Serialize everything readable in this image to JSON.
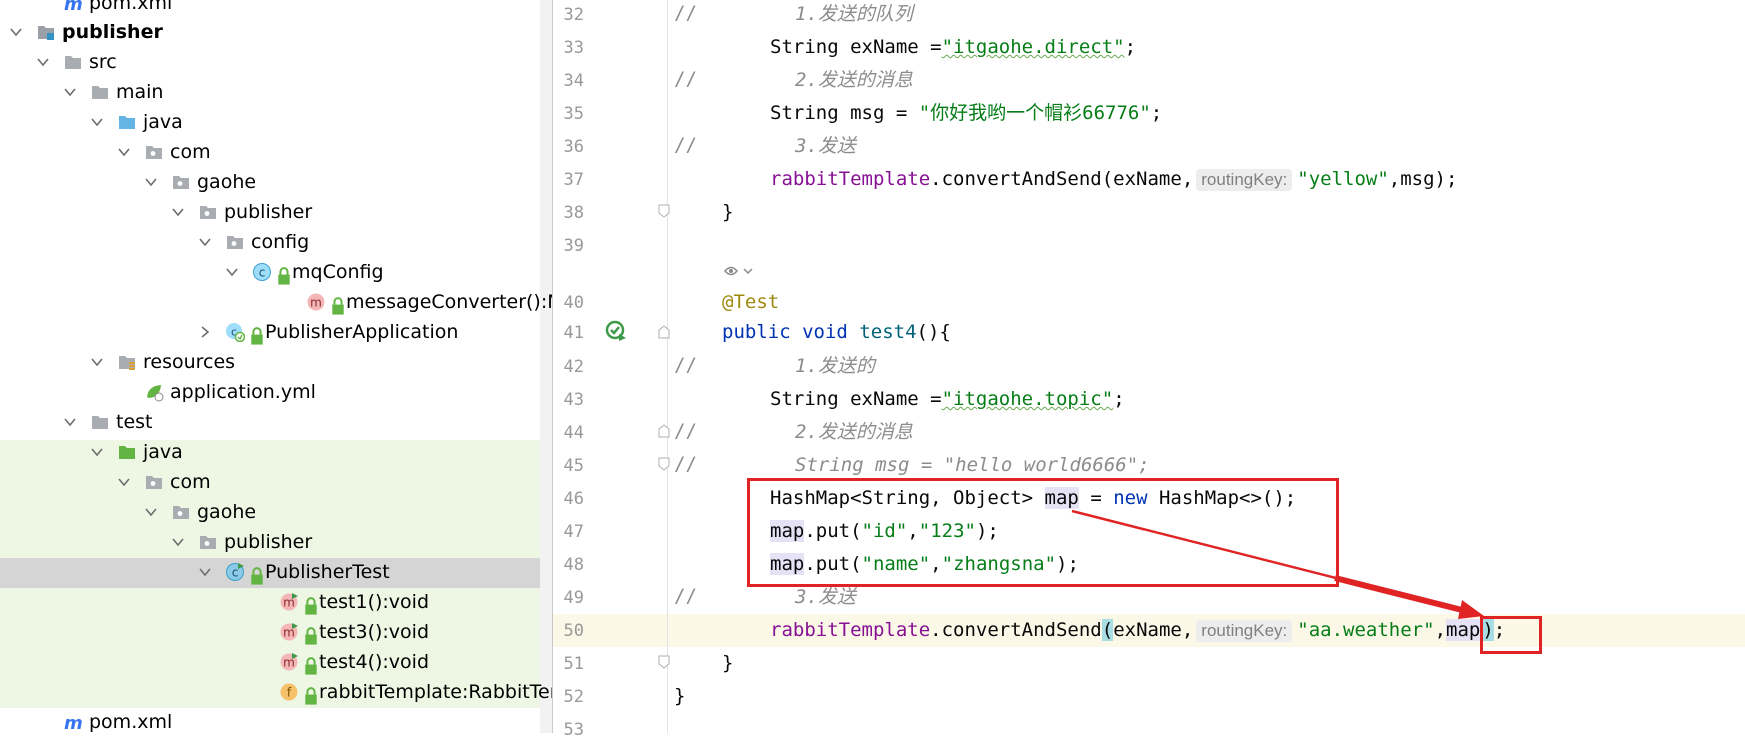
{
  "tree": {
    "rows": [
      {
        "label": "pom.xml",
        "icon": "maven-icon"
      },
      {
        "label": "publisher",
        "icon": "module-folder-icon"
      },
      {
        "label": "src",
        "icon": "folder-icon"
      },
      {
        "label": "main",
        "icon": "folder-icon"
      },
      {
        "label": "java",
        "icon": "source-root-folder-icon"
      },
      {
        "label": "com",
        "icon": "package-icon"
      },
      {
        "label": "gaohe",
        "icon": "package-icon"
      },
      {
        "label": "publisher",
        "icon": "package-icon"
      },
      {
        "label": "config",
        "icon": "package-icon"
      },
      {
        "label": "mqConfig",
        "icon": "class-icon"
      },
      {
        "label": "messageConverter():MessageConverter",
        "icon": "method-icon"
      },
      {
        "label": "PublisherApplication",
        "icon": "spring-boot-class-icon"
      },
      {
        "label": "resources",
        "icon": "resources-folder-icon"
      },
      {
        "label": "application.yml",
        "icon": "spring-yml-icon"
      },
      {
        "label": "test",
        "icon": "folder-icon"
      },
      {
        "label": "java",
        "icon": "test-root-folder-icon"
      },
      {
        "label": "com",
        "icon": "package-icon"
      },
      {
        "label": "gaohe",
        "icon": "package-icon"
      },
      {
        "label": "publisher",
        "icon": "package-icon"
      },
      {
        "label": "PublisherTest",
        "icon": "test-class-icon"
      },
      {
        "label": "test1():void",
        "icon": "test-method-icon"
      },
      {
        "label": "test3():void",
        "icon": "test-method-icon"
      },
      {
        "label": "test4():void",
        "icon": "test-method-icon"
      },
      {
        "label": "rabbitTemplate:RabbitTemplate",
        "icon": "field-icon"
      },
      {
        "label": "pom.xml",
        "icon": "maven-icon"
      }
    ]
  },
  "editor": {
    "line_numbers": [
      "32",
      "33",
      "34",
      "35",
      "36",
      "37",
      "38",
      "39",
      "40",
      "41",
      "42",
      "43",
      "44",
      "45",
      "46",
      "47",
      "48",
      "49",
      "50",
      "51",
      "52",
      "53"
    ],
    "comment_prefix": "//",
    "l32": "1.发送的队列",
    "l33": {
      "a": "String exName =",
      "b": "\"itgaohe.direct\"",
      "c": ";"
    },
    "l34": "2.发送的消息",
    "l35": {
      "a": "String msg = ",
      "b": "\"你好我哟一个帽衫66776\"",
      "c": ";"
    },
    "l36": "3.发送",
    "l37": {
      "a": "rabbitTemplate",
      "b": ".convertAndSend(exName,",
      "hint": "routingKey:",
      "c": "\"yellow\"",
      "d": ",msg);"
    },
    "l38": "}",
    "l40": "@Test",
    "l41": {
      "a": "public",
      "b": "void",
      "c": "test4",
      "d": "(){"
    },
    "l42": "1.发送的",
    "l43": {
      "a": "String exName =",
      "b": "\"itgaohe.topic\"",
      "c": ";"
    },
    "l44": "2.发送的消息",
    "l45": "String msg = \"hello world6666\";",
    "l46": {
      "a": "HashMap<String, Object> ",
      "b": "map",
      "c": " = ",
      "d": "new",
      "e": " HashMap<>();"
    },
    "l47": {
      "a": "map",
      "b": ".put(",
      "c": "\"id\"",
      "d": ",",
      "e": "\"123\"",
      "f": ");"
    },
    "l48": {
      "a": "map",
      "b": ".put(",
      "c": "\"name\"",
      "d": ",",
      "e": "\"zhangsna\"",
      "f": ");"
    },
    "l49": "3.发送",
    "l50": {
      "a": "rabbitTemplate",
      "b": ".convertAndSend",
      "p": "(",
      "c": "exName,",
      "hint": "routingKey:",
      "d": "\"aa.weather\"",
      "e": ",",
      "f": "map",
      "g": ")",
      "h": ";"
    },
    "l51": "}",
    "l52": "}"
  }
}
